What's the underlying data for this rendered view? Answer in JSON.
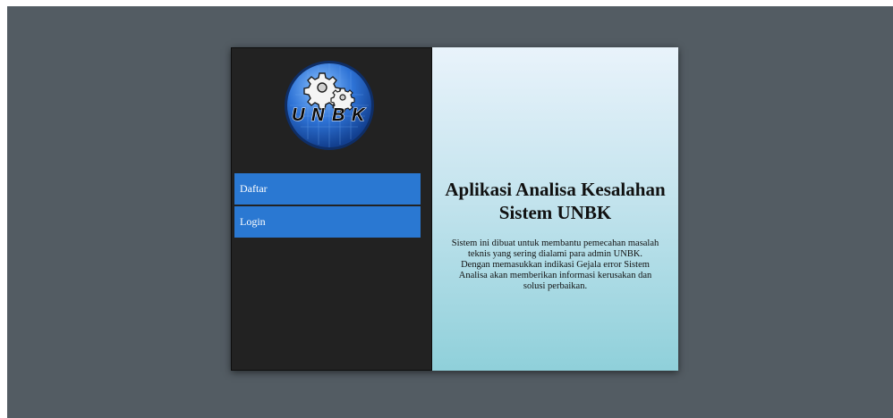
{
  "brand": {
    "logo_text": "UNBK",
    "logo_letters": [
      "U",
      "N",
      "B",
      "K"
    ]
  },
  "nav": {
    "items": [
      {
        "label": "Daftar"
      },
      {
        "label": "Login"
      }
    ]
  },
  "main": {
    "title_line1": "Aplikasi Analisa Kesalahan",
    "title_line2": "Sistem UNBK",
    "desc_lines": [
      "Sistem ini dibuat untuk membantu pemecahan masalah",
      "teknis yang sering dialami para admin UNBK.",
      "Dengan memasukkan indikasi Gejala error Sistem",
      "Analisa akan memberikan informasi kerusakan dan",
      "solusi perbaikan."
    ]
  },
  "colors": {
    "page_bg": "#535c63",
    "sidebar_bg": "#222222",
    "nav_item_bg": "#2a78d2",
    "main_gradient_top": "#e9f3fb",
    "main_gradient_bottom": "#8fd0da"
  },
  "icons": {
    "logo": "gears-globe-logo-icon"
  }
}
